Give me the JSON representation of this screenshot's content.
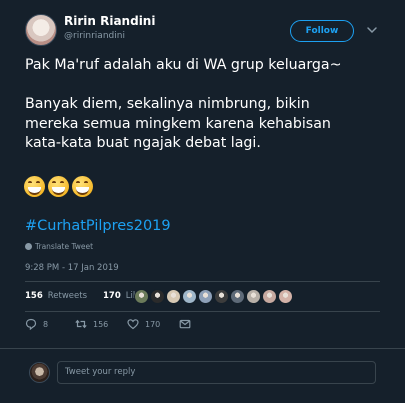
{
  "user": {
    "name": "Ririn Riandini",
    "handle": "@ririnriandini",
    "avatar_icon": "profile-photo"
  },
  "header": {
    "follow_label": "Follow",
    "menu_icon": "chevron-down-icon"
  },
  "tweet": {
    "text": "Pak Ma'ruf adalah aku di WA grup keluarga~\n\nBanyak diem, sekalinya nimbrung, bikin\nmereka semua mingkem karena kehabisan\nkata-kata buat ngajak debat lagi.",
    "emoji_count": 3,
    "emoji_icon": "grinning-face-with-smiling-eyes",
    "hashtag": "#CurhatPilpres2019",
    "translate_label": "Translate Tweet",
    "timestamp": "9:28 PM - 17 Jan 2019"
  },
  "stats": {
    "retweets_count": "156",
    "retweets_label": "Retweets",
    "likes_count": "170",
    "likes_label": "Likes"
  },
  "likers": {
    "colors": [
      "#6b7b5a",
      "#2b2b2b",
      "#d7c9b4",
      "#9fb6c9",
      "#8ea0b8",
      "#3c3c3c",
      "#5e6a78",
      "#b8b0a8",
      "#c7a9a0",
      "#d3b2a8"
    ]
  },
  "actions": {
    "reply_count": "8",
    "retweet_count": "156",
    "like_count": "170"
  },
  "reply": {
    "placeholder": "Tweet your reply"
  },
  "colors": {
    "background": "#15202b",
    "accent": "#1da1f2",
    "muted": "#8899a6",
    "divider": "#38444d"
  }
}
